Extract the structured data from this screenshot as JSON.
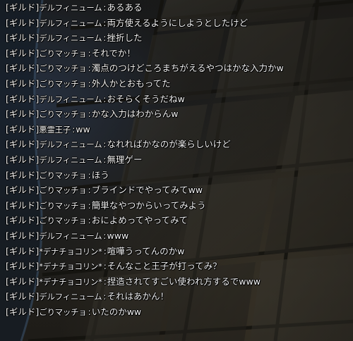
{
  "chat": {
    "channel_label": "[ギルド]",
    "separator": ":",
    "messages": [
      {
        "speaker": "デルフィニューム",
        "text": "あるある"
      },
      {
        "speaker": "デルフィニューム",
        "text": "両方使えるようにしようとしたけど"
      },
      {
        "speaker": "デルフィニューム",
        "text": "挫折した"
      },
      {
        "speaker": "ごりマッチョ",
        "text": "それでか！"
      },
      {
        "speaker": "ごりマッチョ",
        "text": "濁点のつけどころまちがえるやつはかな入力かw"
      },
      {
        "speaker": "ごりマッチョ",
        "text": "外人かとおもってた"
      },
      {
        "speaker": "デルフィニューム",
        "text": "おそらくそうだねw"
      },
      {
        "speaker": "ごりマッチョ",
        "text": "かな入力はわからんw"
      },
      {
        "speaker": "悪霊王子",
        "text": "ww"
      },
      {
        "speaker": "デルフィニューム",
        "text": "なれればかなのが楽らしいけど"
      },
      {
        "speaker": "デルフィニューム",
        "text": "無理ゲー"
      },
      {
        "speaker": "ごりマッチョ",
        "text": "ほう"
      },
      {
        "speaker": "ごりマッチョ",
        "text": "ブラインドでやってみてww"
      },
      {
        "speaker": "ごりマッチョ",
        "text": "簡単なやつからいってみよう"
      },
      {
        "speaker": "ごりマッチョ",
        "text": "おによめってやってみて"
      },
      {
        "speaker": "デルフィニューム",
        "text": "www"
      },
      {
        "speaker": "*デナチョコリン*",
        "text": "喧嘩うってんのかw"
      },
      {
        "speaker": "*デナチョコリン*",
        "text": "そんなこと王子が打ってみ？"
      },
      {
        "speaker": "*デナチョコリン*",
        "text": "捏造されてすごい使われ方するでwww"
      },
      {
        "speaker": "デルフィニューム",
        "text": "それはあかん！"
      },
      {
        "speaker": "ごりマッチョ",
        "text": "いたのかww"
      }
    ]
  }
}
